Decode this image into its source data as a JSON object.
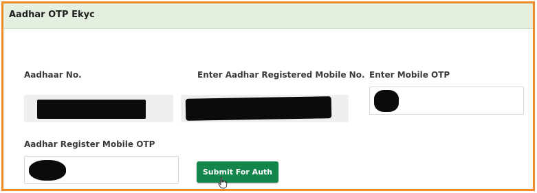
{
  "panel": {
    "title": "Aadhar OTP Ekyc",
    "border_color": "#f08a24",
    "header_color": "#e4efdf"
  },
  "form": {
    "aadhaar_no": {
      "label": "Aadhaar No."
    },
    "registered_mobile": {
      "label": "Enter Aadhar Registered Mobile No."
    },
    "mobile_otp": {
      "label": "Enter Mobile OTP"
    },
    "register_mobile_otp": {
      "label": "Aadhar Register Mobile OTP"
    },
    "submit": {
      "label": "Submit For Auth",
      "color": "#14854b"
    }
  },
  "icons": {
    "cursor": "hand-pointer-icon"
  }
}
